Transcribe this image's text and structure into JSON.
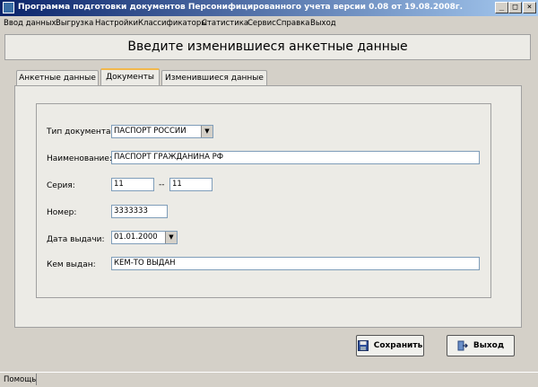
{
  "window": {
    "title": "Программа подготовки документов Персонифицированного учета версии 0.08 от 19.08.2008г.",
    "minimize": "_",
    "maximize": "□",
    "close": "×"
  },
  "menu": [
    "Ввод данных",
    "Выгрузка",
    "Настройки",
    "Классификаторы",
    "Статистика",
    "Сервис",
    "Справка",
    "Выход"
  ],
  "header": {
    "title": "Введите изменившиеся анкетные данные"
  },
  "tabs": [
    "Анкетные данные",
    "Документы",
    "Изменившиеся данные"
  ],
  "active_tab": "Документы",
  "form": {
    "doc_type_label": "Тип документа:",
    "doc_type_value": "ПАСПОРТ РОССИИ",
    "name_label": "Наименование:",
    "name_value": "ПАСПОРТ ГРАЖДАНИНА РФ",
    "series_label": "Серия:",
    "series_value_1": "11",
    "series_sep": "--",
    "series_value_2": "11",
    "number_label": "Номер:",
    "number_value": "3333333",
    "issue_date_label": "Дата выдачи:",
    "issue_date_value": "01.01.2000",
    "issued_by_label": "Кем выдан:",
    "issued_by_value": "КЕМ-ТО ВЫДАН"
  },
  "buttons": {
    "save": "Сохранить",
    "exit": "Выход"
  },
  "status": {
    "text": "Помощь"
  },
  "icons": {
    "save": "floppy-disk-icon",
    "exit": "exit-door-icon",
    "dropdown": "chevron-down-icon"
  },
  "colors": {
    "titlebar_start": "#0a246a",
    "titlebar_end": "#a6caf0",
    "active_tab_accent": "#f2b84b"
  }
}
